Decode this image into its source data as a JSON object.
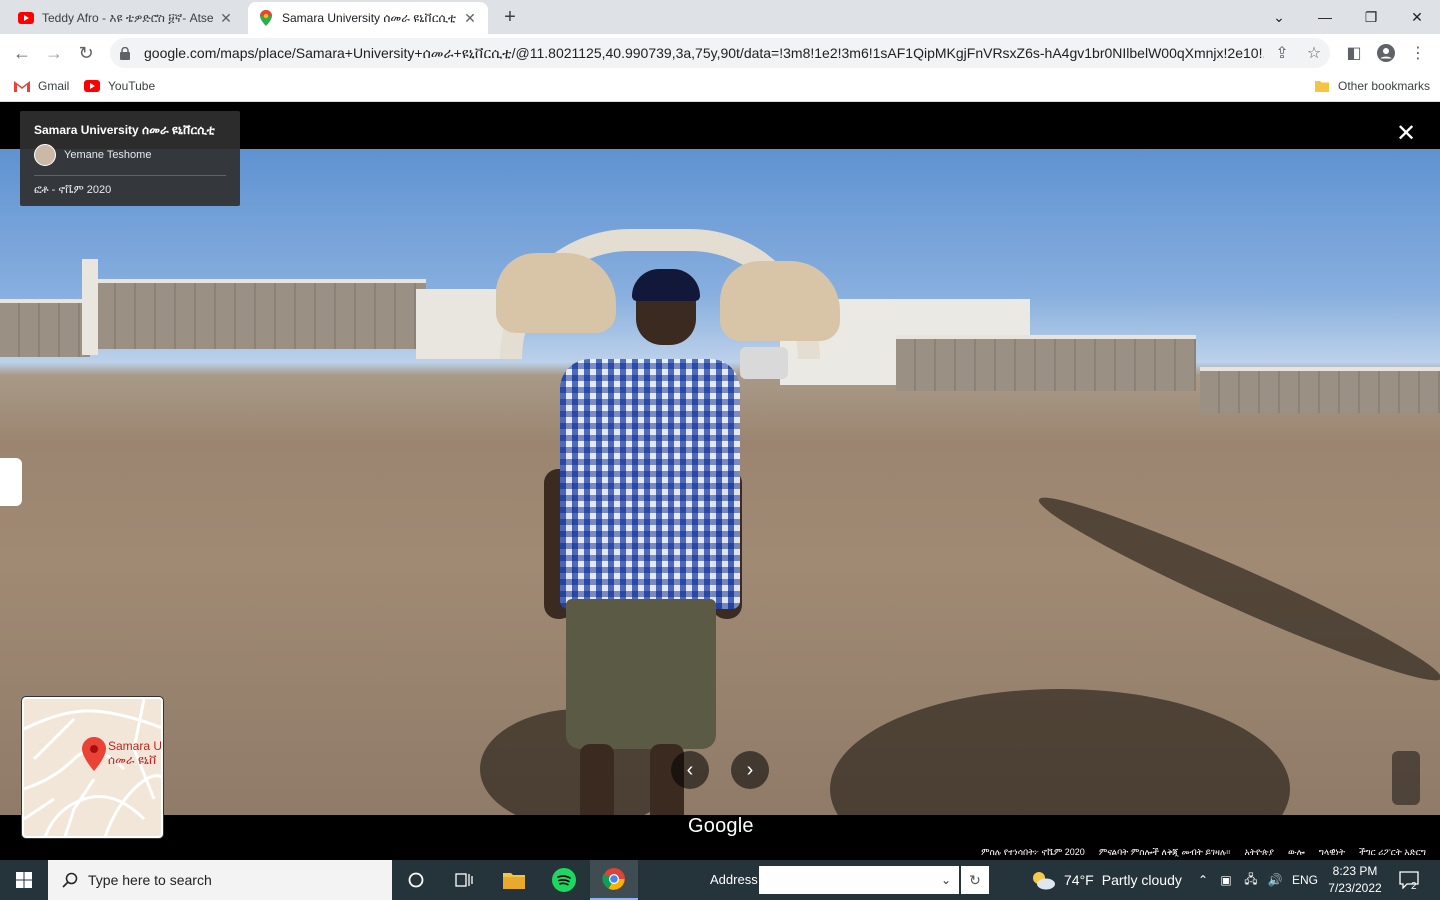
{
  "browser": {
    "tabs": [
      {
        "title": "Teddy Afro - እዩ ቴዎድሮስ ፱ኛ- Atse",
        "icon": "youtube-icon"
      },
      {
        "title": "Samara University ሰመራ ዩኒቨርሲቲ",
        "icon": "google-maps-icon"
      }
    ],
    "url": "google.com/maps/place/Samara+University+ሰመራ+ዩኒቨርሲቲ/@11.8021125,40.990739,3a,75y,90t/data=!3m8!1e2!3m6!1sAF1QipMKgjFnVRsxZ6s-hA4gv1br0NIlbelW00qXmnjx!2e10!...",
    "bookmarks": [
      {
        "label": "Gmail",
        "icon": "gmail-icon"
      },
      {
        "label": "YouTube",
        "icon": "youtube-icon"
      }
    ],
    "other_bookmarks": "Other bookmarks"
  },
  "viewer": {
    "place_name": "Samara University ሰመራ ዩኒቨርሲቲ",
    "author": "Yemane Teshome",
    "date": "ፎቶ - ኖቬም 2020",
    "minimap_label_line1": "Samara U",
    "minimap_label_line2": "ሰመራ ዩኒቨ",
    "google_logo": "Google",
    "footer_links": [
      "ምስሉ የተነሳበት፦ ኖቬም 2020",
      "ምናልባት ምስሎች ለቅጂ መብት ይገዛሉ።",
      "አትዮጵያ",
      "ውሎ",
      "ግላዊነት",
      "ችግር ሪፖርት አድርግ"
    ]
  },
  "taskbar": {
    "search_placeholder": "Type here to search",
    "address_label": "Address",
    "weather_temp": "74°F",
    "weather_desc": "Partly cloudy",
    "language": "ENG",
    "time": "8:23 PM",
    "date": "7/23/2022",
    "notification_count": "2"
  },
  "colors": {
    "youtube_red": "#ff0000",
    "maps_red": "#ea4335",
    "taskbar_bg": "#25343b"
  }
}
